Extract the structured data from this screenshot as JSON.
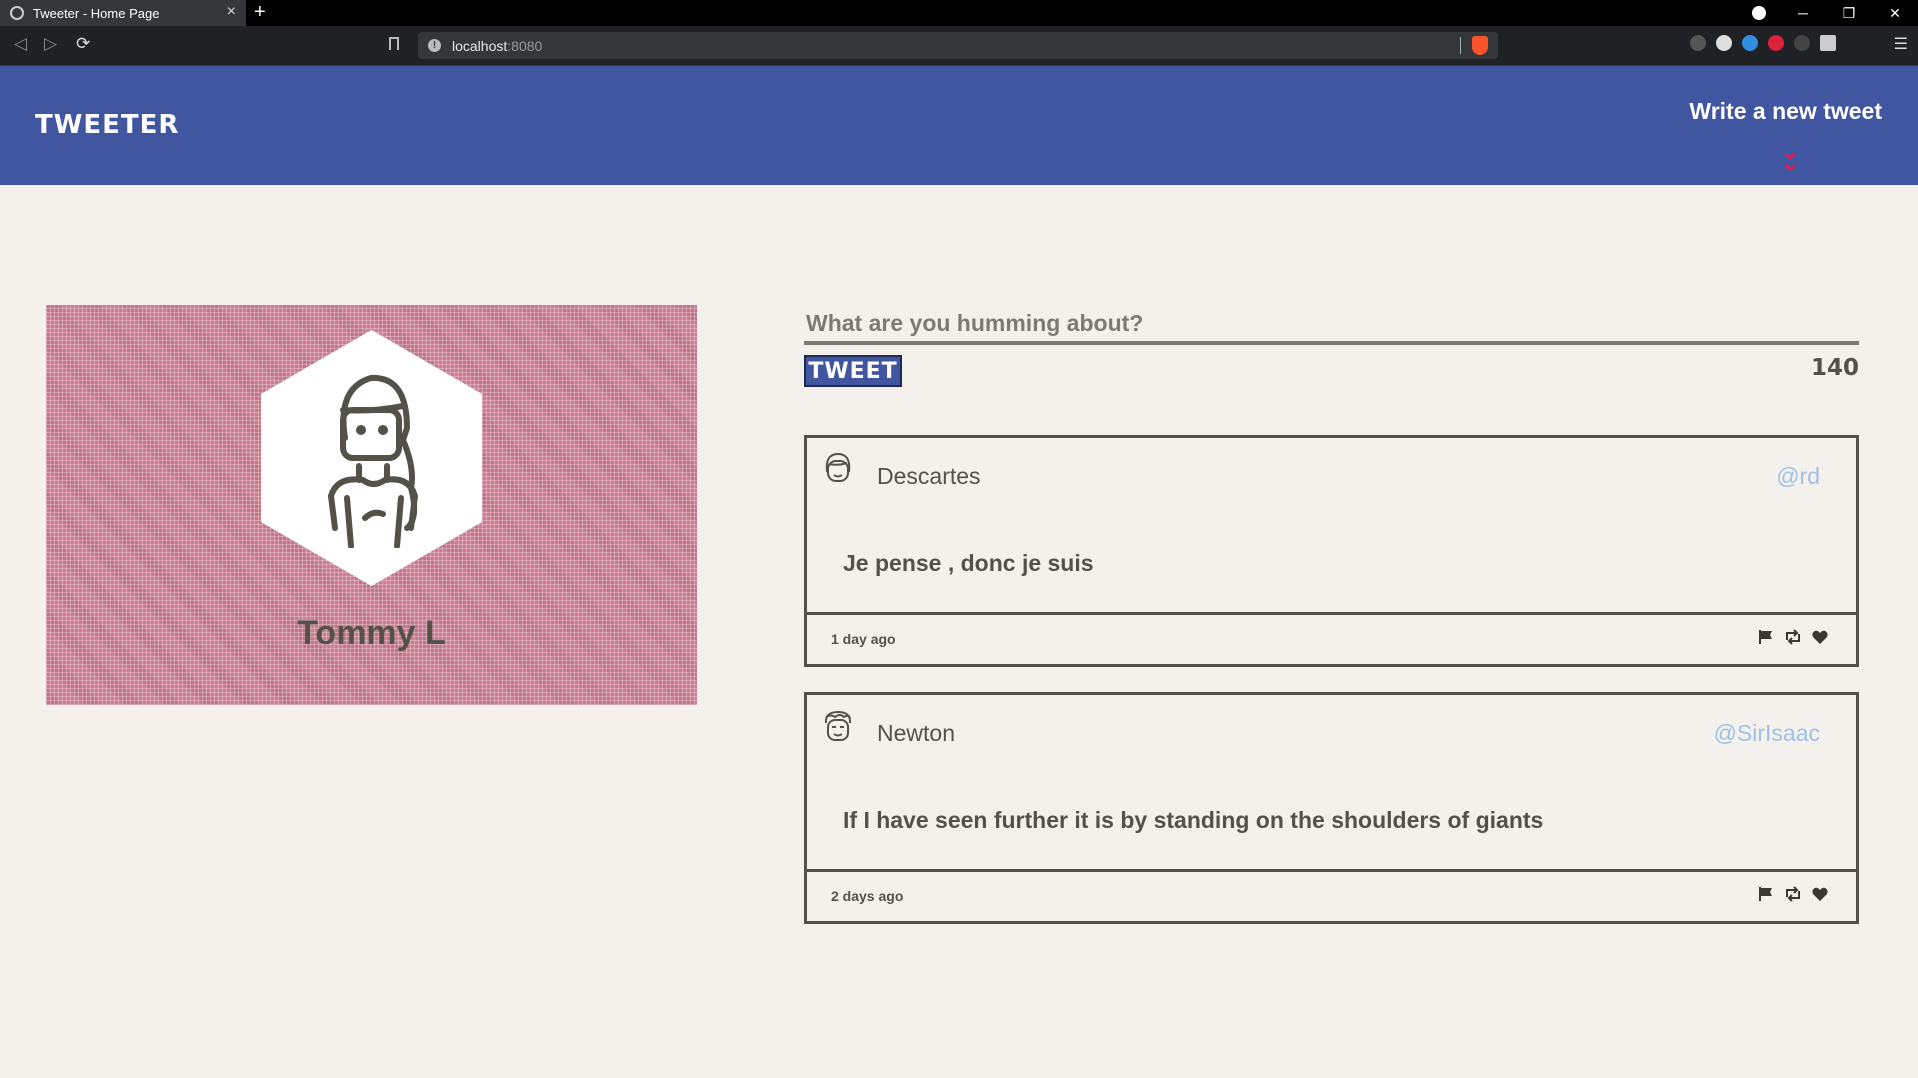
{
  "browser": {
    "tab_title": "Tweeter - Home Page",
    "new_tab": "+",
    "url_host": "localhost",
    "url_port": ":8080",
    "window_controls": [
      "─",
      "❐",
      "✕"
    ]
  },
  "header": {
    "logo": "TWEETER",
    "compose_link": "Write a new tweet",
    "chevron": "»",
    "colors": {
      "background": "#4056a1",
      "chevron": "#e8194b"
    }
  },
  "profile": {
    "name": "Tommy L",
    "avatar_icon": "woman-avatar-icon",
    "card_color": "#cd7b92"
  },
  "compose": {
    "placeholder": "What are you humming about?",
    "button_label": "TWEET",
    "counter": "140"
  },
  "tweets": [
    {
      "name": "Descartes",
      "handle": "@rd",
      "text": "Je pense , donc je suis",
      "time": "1 day ago",
      "avatar_icon": "woman-avatar-icon"
    },
    {
      "name": "Newton",
      "handle": "@SirIsaac",
      "text": "If I have seen further it is by standing on the shoulders of giants",
      "time": "2 days ago",
      "avatar_icon": "man-avatar-icon"
    }
  ],
  "actions": [
    "flag-icon",
    "retweet-icon",
    "heart-icon"
  ]
}
